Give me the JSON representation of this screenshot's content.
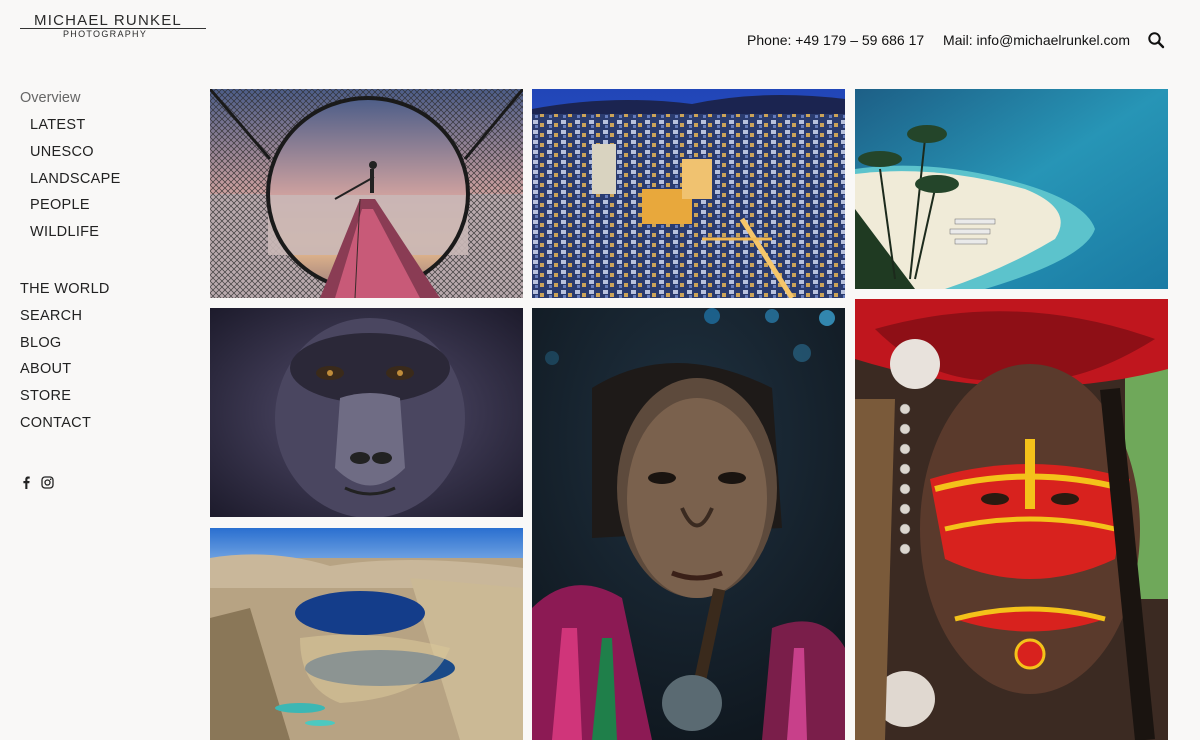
{
  "brand": {
    "name": "MICHAEL RUNKEL",
    "subtitle": "PHOTOGRAPHY"
  },
  "header": {
    "phone": "Phone: +49 179 – 59 686 17",
    "email": "Mail: info@michaelrunkel.com",
    "search_icon": "search-icon"
  },
  "nav": {
    "overview": "Overview",
    "sub_items": [
      "LATEST",
      "UNESCO",
      "LANDSCAPE",
      "PEOPLE",
      "WILDLIFE"
    ],
    "main_items": [
      "THE WORLD",
      "SEARCH",
      "BLOG",
      "ABOUT",
      "STORE",
      "CONTACT"
    ]
  },
  "social": [
    "facebook-icon",
    "instagram-icon"
  ],
  "gallery": {
    "photos": [
      "Fisherman on boat inside a conical net at sunset",
      "Colorful hillside city at dusk",
      "Tropical white sand beach with palm trees and turquoise sea",
      "Close-up of a mountain gorilla face",
      "Aerial view of deep blue mountain lakes in a desert landscape",
      "Portrait of an elderly tattooed woman smoking a pipe",
      "Portrait of a man with red and yellow face paint and feather headdress"
    ]
  },
  "colors": {
    "background": "#f9f8f7",
    "text": "#222222",
    "muted": "#666666"
  }
}
